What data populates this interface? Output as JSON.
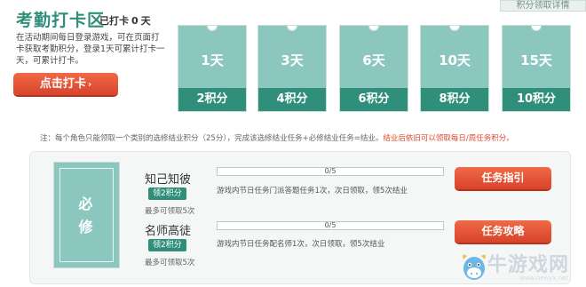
{
  "header": {
    "title": "考勤打卡区",
    "checked_prefix": "已打卡",
    "checked_count": "0",
    "checked_suffix": "天",
    "description": "在活动期间每日登录游戏，可在页面打卡获取考勤积分，登录1天可累计打卡一天，可累计打卡。",
    "checkin_button": "点击打卡",
    "points_link": "积分领取详情"
  },
  "day_cards": [
    {
      "day": "1天",
      "reward": "2积分"
    },
    {
      "day": "3天",
      "reward": "4积分"
    },
    {
      "day": "6天",
      "reward": "6积分"
    },
    {
      "day": "10天",
      "reward": "8积分"
    },
    {
      "day": "15天",
      "reward": "10积分"
    }
  ],
  "note": {
    "text": "注：每个角色只能领取一个类别的选修结业积分（25分），完成该选修结业任务+必修结业任务=结业。",
    "highlight": "结业后依旧可以领取每日/周任务积分。"
  },
  "tasks": {
    "category_line1": "必",
    "category_line2": "修",
    "items": [
      {
        "name": "知己知彼",
        "reward": "领2积分",
        "limit": "最多可领取5次",
        "progress": "0/5",
        "progress_fraction": 0,
        "description": "游戏内节日任务门派答题任务1次，次日领取，领5次结业",
        "button": "任务指引"
      },
      {
        "name": "名师高徒",
        "reward": "领2积分",
        "limit": "最多可领取5次",
        "progress": "0/5",
        "progress_fraction": 0,
        "description": "游戏内节日任务配名师1次，次日领取，领5次结业",
        "button": "任务攻略"
      }
    ]
  },
  "watermark": {
    "text": "牛游戏网",
    "url": "www.newyx.net"
  }
}
